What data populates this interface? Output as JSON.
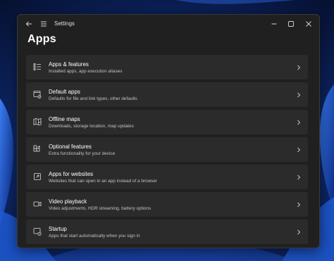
{
  "window": {
    "title": "Settings",
    "page_title": "Apps"
  },
  "items": [
    {
      "label": "Apps & features",
      "desc": "Installed apps, app execution aliases",
      "icon": "apps-list-icon"
    },
    {
      "label": "Default apps",
      "desc": "Defaults for file and link types, other defaults",
      "icon": "default-apps-icon"
    },
    {
      "label": "Offline maps",
      "desc": "Downloads, storage location, map updates",
      "icon": "map-icon"
    },
    {
      "label": "Optional features",
      "desc": "Extra functionality for your device",
      "icon": "optional-features-icon"
    },
    {
      "label": "Apps for websites",
      "desc": "Websites that can open in an app instead of a browser",
      "icon": "apps-for-websites-icon"
    },
    {
      "label": "Video playback",
      "desc": "Video adjustments, HDR streaming, battery options",
      "icon": "video-icon"
    },
    {
      "label": "Startup",
      "desc": "Apps that start automatically when you sign in",
      "icon": "startup-icon"
    }
  ],
  "colors": {
    "window_bg": "#202020",
    "card_bg": "#2b2b2b",
    "text_primary": "#ffffff",
    "text_secondary": "#c2c2c2"
  }
}
